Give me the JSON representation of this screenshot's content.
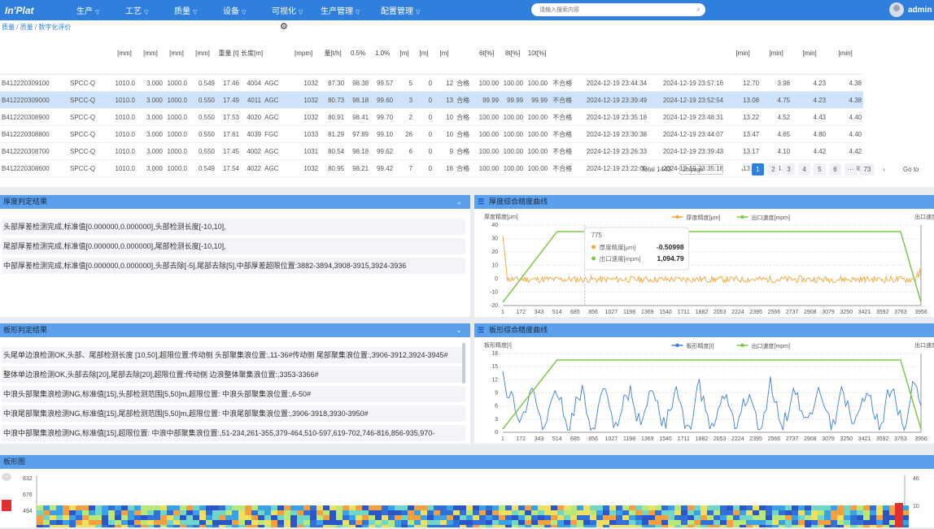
{
  "app": {
    "logo": "In'Plat"
  },
  "nav": [
    {
      "label": "生产"
    },
    {
      "label": "工艺"
    },
    {
      "label": "质量"
    },
    {
      "label": "设备"
    },
    {
      "label": "可视化"
    },
    {
      "label": "生产管理"
    },
    {
      "label": "配置管理"
    }
  ],
  "search": {
    "placeholder": "请输入搜索内容"
  },
  "user": {
    "name": "admin"
  },
  "breadcrumb": "质量 / 质量 / 数字化评价",
  "table": {
    "headers": [
      "",
      "",
      "[mm]",
      "[mm]",
      "[mm]",
      "[mm]",
      "重量 [t]",
      "长度[m]",
      "",
      "[mpm]",
      "量[t/h]",
      "0.5%",
      "1.0%",
      "[m]",
      "[m]",
      "[m]",
      "",
      "6t[%]",
      "8t[%]",
      "10t[%]",
      "",
      "",
      "",
      "[min]",
      "[min]",
      "[min]",
      "[min]"
    ],
    "rows": [
      [
        "B412220309100",
        "SPCC-Q",
        "1010.0",
        "3.000",
        "1000.0",
        "0.549",
        "17.46",
        "4004",
        "AGC",
        "1032",
        "87.30",
        "98.38",
        "99.57",
        "5",
        "0",
        "12",
        "合格",
        "100.00",
        "100.00",
        "100.00",
        "不合格",
        "2024-12-19 23:44:34",
        "2024-12-19 23:57:16",
        "12.70",
        "3.98",
        "4.23",
        "4.38"
      ],
      [
        "B412220309000",
        "SPCC-Q",
        "1010.0",
        "3.000",
        "1000.0",
        "0.550",
        "17.49",
        "4011",
        "AGC",
        "1032",
        "80.73",
        "98.18",
        "99.60",
        "3",
        "0",
        "13",
        "合格",
        "99.99",
        "99.99",
        "99.99",
        "不合格",
        "2024-12-19 23:39:49",
        "2024-12-19 23:52:54",
        "13.08",
        "4.75",
        "4.23",
        "4.38"
      ],
      [
        "B412220308900",
        "SPCC-Q",
        "1010.0",
        "3.000",
        "1000.0",
        "0.550",
        "17.53",
        "4020",
        "AGC",
        "1032",
        "80.91",
        "98.41",
        "99.70",
        "2",
        "0",
        "10",
        "合格",
        "100.00",
        "100.00",
        "100.00",
        "不合格",
        "2024-12-19 23:35:18",
        "2024-12-19 23:48:31",
        "13.22",
        "4.52",
        "4.43",
        "4.40"
      ],
      [
        "B412220308800",
        "SPCC-Q",
        "1010.0",
        "3.000",
        "1000.0",
        "0.550",
        "17.61",
        "4039",
        "FGC",
        "1033",
        "81.29",
        "97.89",
        "99.10",
        "26",
        "0",
        "10",
        "合格",
        "100.00",
        "100.00",
        "100.00",
        "不合格",
        "2024-12-19 23:30:38",
        "2024-12-19 23:44:07",
        "13.47",
        "4.65",
        "4.80",
        "4.40"
      ],
      [
        "B412220308700",
        "SPCC-Q",
        "1010.0",
        "3.000",
        "1000.0",
        "0.550",
        "17.45",
        "4002",
        "AGC",
        "1031",
        "80.54",
        "98.18",
        "99.62",
        "6",
        "0",
        "9",
        "合格",
        "100.00",
        "100.00",
        "100.00",
        "不合格",
        "2024-12-19 23:26:33",
        "2024-12-19 23:39:43",
        "13.17",
        "4.10",
        "4.42",
        "4.42"
      ],
      [
        "B412220308600",
        "SPCC-Q",
        "1010.0",
        "3.000",
        "1000.0",
        "0.549",
        "17.54",
        "4022",
        "AGC",
        "1032",
        "80.95",
        "98.21",
        "99.42",
        "7",
        "0",
        "16",
        "合格",
        "100.00",
        "100.00",
        "100.00",
        "不合格",
        "2024-12-19 23:22:00",
        "2024-12-19 23:35:18",
        "13.30",
        "4.55",
        "4.37",
        "4.38"
      ]
    ],
    "selected_row": 1
  },
  "pager": {
    "total": "Total 1443",
    "page_size": "20/page",
    "pages": [
      "1",
      "2",
      "3",
      "4",
      "5",
      "6",
      "···",
      "73"
    ],
    "prev": "‹",
    "next": "›",
    "goto": "Go to"
  },
  "panels": {
    "thickness_result": {
      "title": "厚度判定结果",
      "lines": [
        "头部厚差检测完成,标准值[0.000000,0.000000],头部检测长度[-10,10],",
        "尾部厚差检测完成,标准值[0.000000,0.000000],尾部检测长度[-10,10],",
        "中部厚差检测完成,标准值[0.000000,0.000000],头部去除[-5],尾部去除[5],中部厚差超限位置:3882-3894,3908-3915,3924-3936"
      ]
    },
    "thickness_curve": {
      "title": "厚度综合精度曲线"
    },
    "shape_result": {
      "title": "板形判定结果",
      "lines": [
        "头尾单边浪检测OK,头部、尾部检测长度 [10,50],超限位置:传动侧 头部聚集浪位置:,11-36#传动侧 尾部聚集浪位置:,3906-3912,3924-3945#",
        "整体单边浪检测OK,头部去除[20],尾部去除[20],超限位置:传动侧 边浪整体聚集浪位置:,3353-3366#",
        "中浪头部聚集浪检测NG,标准值[15],头部检测范围[5,50]m,超限位置: 中浪头部聚集浪位置:,6-50#",
        "中浪尾部聚集浪检测NG,标准值[15],尾部检测范围[5,50]m,超限位置: 中浪尾部聚集浪位置:,3906-3918,3930-3950#",
        "中浪中部聚集浪检测NG,标准值[15],超限位置: 中浪中部聚集浪位置:,51-234,261-355,379-464,510-597,619-702,746-816,856-935,970-"
      ]
    },
    "shape_curve": {
      "title": "板形综合精度曲线"
    },
    "heatmap": {
      "title": "板形图"
    }
  },
  "colors": {
    "accent": "#2f7fdc",
    "panel_header": "#5ba0ec",
    "orange": "#f4a53d",
    "green": "#7dc84a",
    "blue_line": "#3c7fd8"
  },
  "chart_data": [
    {
      "type": "line",
      "title": "",
      "ylabel": "厚度精度[μm]",
      "y2label": "出口速度[",
      "x": [
        "1",
        "172",
        "343",
        "514",
        "685",
        "856",
        "1027",
        "1198",
        "1369",
        "1540",
        "1711",
        "1882",
        "2053",
        "2224",
        "2395",
        "2566",
        "2737",
        "2908",
        "3079",
        "3250",
        "3421",
        "3592",
        "3763",
        "3956"
      ],
      "ylim": [
        -20,
        40
      ],
      "yticks": [
        40,
        30,
        20,
        10,
        0,
        -10,
        -20
      ],
      "y2ticks": [
        "1",
        "1",
        "",
        "",
        "",
        "",
        "",
        ""
      ],
      "series": [
        {
          "name": "厚度精度[μm]",
          "color": "#f4a53d",
          "axis": "left",
          "profile": "noise",
          "baseline": -0.5,
          "amp": 2.5
        },
        {
          "name": "出口速度[mpm]",
          "color": "#7dc84a",
          "axis": "right",
          "profile": "trapezoid",
          "low": 0,
          "high": 1094.79,
          "ramp_end": 514,
          "ramp_down": 3763,
          "end": 3956
        }
      ],
      "tooltip": {
        "x": "775",
        "rows": [
          {
            "name": "厚度精度[μm]",
            "value": "-0.50998"
          },
          {
            "name": "出口速度[mpm]",
            "value": "1,094.79"
          }
        ]
      },
      "legend_prefix": "[μm]"
    },
    {
      "type": "line",
      "title": "",
      "ylabel": "板形精度[I]",
      "y2label": "出口速度[",
      "x": [
        "1",
        "172",
        "343",
        "514",
        "685",
        "856",
        "1027",
        "1198",
        "1369",
        "1540",
        "1711",
        "1882",
        "2053",
        "2224",
        "2395",
        "2566",
        "2737",
        "2908",
        "3079",
        "3250",
        "3421",
        "3592",
        "3763",
        "3956"
      ],
      "ylim": [
        0,
        18
      ],
      "yticks": [
        18,
        15,
        12,
        9,
        6,
        3,
        0
      ],
      "series": [
        {
          "name": "板形精度[I]",
          "color": "#3c7fd8",
          "axis": "left",
          "profile": "wave",
          "baseline": 5,
          "amp": 4
        },
        {
          "name": "出口速度[mpm]",
          "color": "#7dc84a",
          "axis": "right",
          "profile": "trapezoid",
          "low": 0,
          "high": 1094.79,
          "ramp_end": 514,
          "ramp_down": 3763,
          "end": 3956
        }
      ]
    },
    {
      "type": "heatmap",
      "yticks": [
        "832",
        "676",
        "494"
      ],
      "y2ticks": [
        "46",
        "10"
      ]
    }
  ]
}
